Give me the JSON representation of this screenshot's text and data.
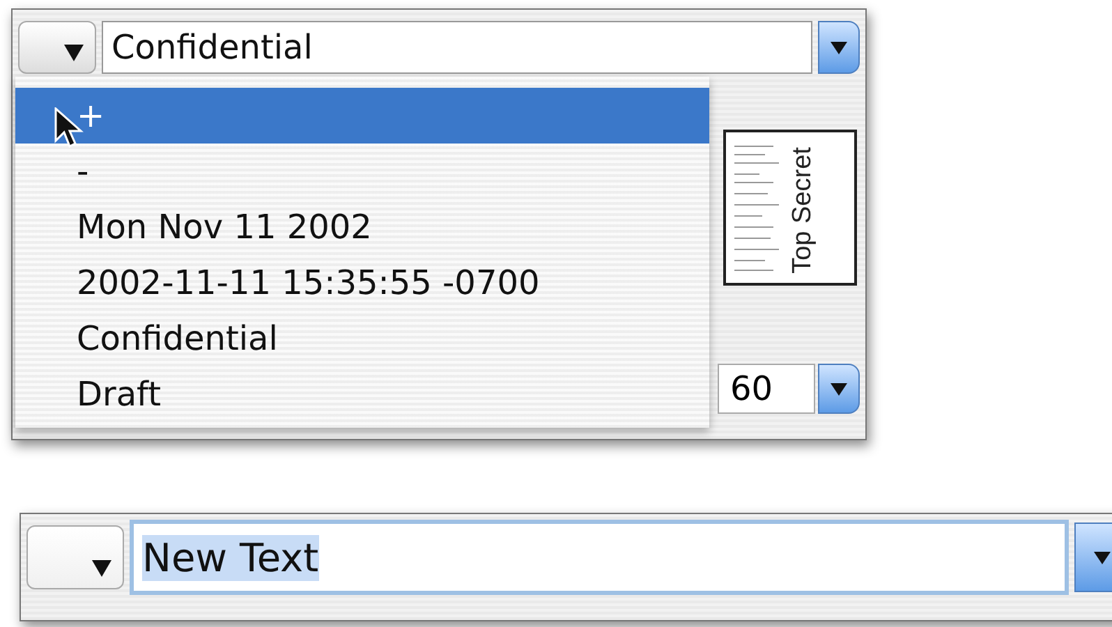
{
  "top_window": {
    "combo": {
      "value": "Confidential"
    },
    "menu": {
      "items": [
        {
          "label": "+",
          "selected": true
        },
        {
          "label": "-",
          "selected": false
        },
        {
          "label": "Mon Nov 11 2002",
          "selected": false
        },
        {
          "label": "2002-11-11 15:35:55 -0700",
          "selected": false
        },
        {
          "label": "Confidential",
          "selected": false
        },
        {
          "label": "Draft",
          "selected": false
        }
      ]
    },
    "preview": {
      "label": "Top Secret"
    },
    "size_field": {
      "value": "60"
    }
  },
  "bottom_window": {
    "combo": {
      "value": "New Text",
      "text_selected": true
    }
  }
}
